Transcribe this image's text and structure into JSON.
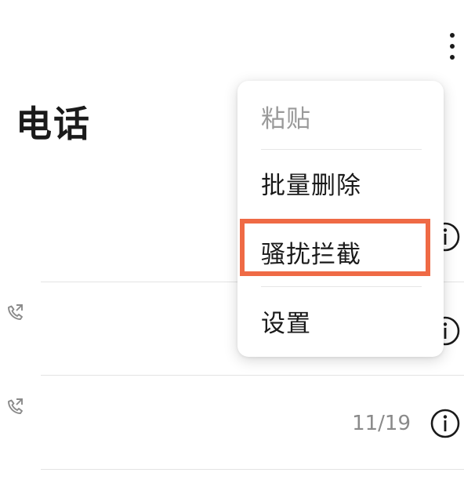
{
  "header": {
    "title": "电话",
    "more_icon": "more-vertical-icon"
  },
  "call_list": [
    {
      "icon": "outgoing-call-icon",
      "date": "",
      "info_icon": "info-icon"
    },
    {
      "icon": "outgoing-call-icon",
      "date": "11/19",
      "info_icon": "info-icon"
    }
  ],
  "menu": {
    "items": [
      {
        "label": "粘贴",
        "enabled": false
      },
      {
        "label": "批量删除",
        "enabled": true
      },
      {
        "label": "骚扰拦截",
        "enabled": true,
        "highlighted": true
      },
      {
        "label": "设置",
        "enabled": true
      }
    ]
  },
  "colors": {
    "highlight": "#ef6a45",
    "text": "#1a1a1a",
    "muted": "#8a8a8a"
  }
}
